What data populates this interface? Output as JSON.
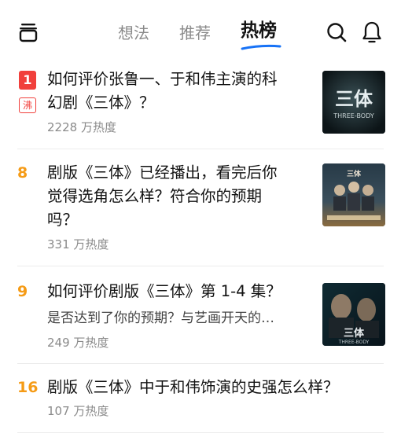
{
  "tabs": [
    {
      "label": "想法"
    },
    {
      "label": "推荐"
    },
    {
      "label": "热榜"
    }
  ],
  "items": [
    {
      "rank": "1",
      "hot_tag": "沸",
      "title_lines": [
        "如何评价张鲁一、于和伟主演的科",
        "幻剧《三体》？"
      ],
      "heat": "2228 万热度",
      "thumb_text": "三体",
      "thumb_sub": "THREE-BODY"
    },
    {
      "rank": "8",
      "title_lines": [
        "剧版《三体》已经播出，看完后你",
        "觉得选角怎么样？符合你的预期",
        "吗？"
      ],
      "heat": "331 万热度",
      "thumb_text": "三体"
    },
    {
      "rank": "9",
      "title_lines": [
        "如何评价剧版《三体》第 1-4 集？"
      ],
      "excerpt": "是否达到了你的预期？与艺画开天的…",
      "heat": "249 万热度",
      "thumb_text": "三体",
      "thumb_sub": "THREE-BODY"
    },
    {
      "rank": "16",
      "title_lines": [
        "剧版《三体》中于和伟饰演的史强怎么样？"
      ],
      "heat": "107 万热度"
    }
  ],
  "colors": {
    "rank_top": "#f1403c",
    "rank": "#f59b16",
    "accent": "#1772f6"
  }
}
